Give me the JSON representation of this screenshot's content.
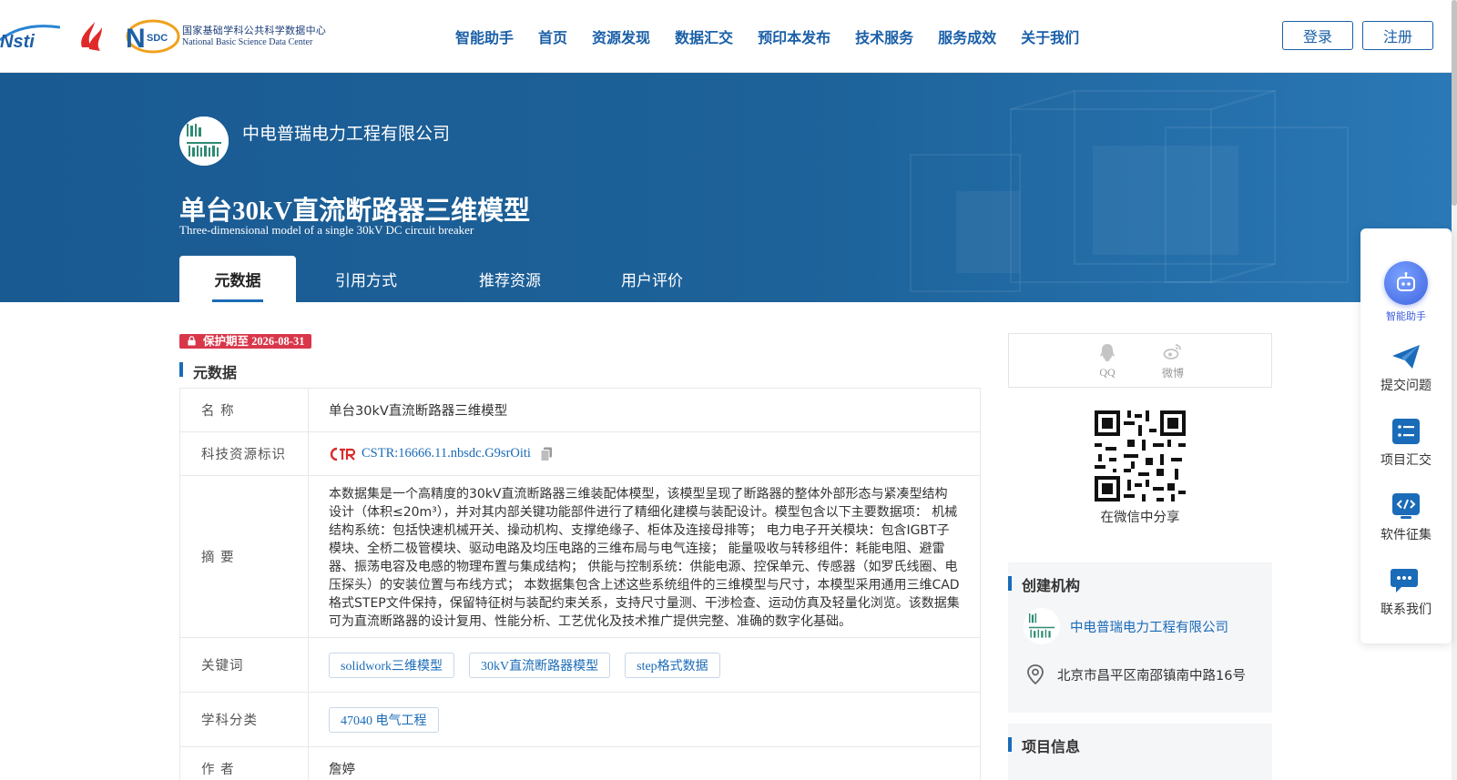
{
  "nav": {
    "logo_cstr_text": "Nsti",
    "nsdc_cn": "国家基础学科公共科学数据中心",
    "nsdc_en": "National Basic Science Data Center",
    "nsdc_mark": "SDC",
    "items": [
      "智能助手",
      "首页",
      "资源发现",
      "数据汇交",
      "预印本发布",
      "技术服务",
      "服务成效",
      "关于我们"
    ],
    "login": "登录",
    "register": "注册"
  },
  "banner": {
    "org_name": "中电普瑞电力工程有限公司",
    "title": "单台30kV直流断路器三维模型",
    "subtitle": "Three-dimensional model of a single 30kV DC circuit breaker",
    "tabs": [
      "元数据",
      "引用方式",
      "推荐资源",
      "用户评价"
    ],
    "active_tab": 0
  },
  "meta": {
    "protect_label": "保护期至 2026-08-31",
    "section_title": "元数据",
    "rows": {
      "name_label": "名 称",
      "name_value": "单台30kV直流断路器三维模型",
      "id_label": "科技资源标识",
      "id_value": "CSTR:16666.11.nbsdc.G9srOiti",
      "abstract_label": "摘 要",
      "abstract_value": "本数据集是一个高精度的30kV直流断路器三维装配体模型，该模型呈现了断路器的整体外部形态与紧凑型结构设计（体积≤20m³），并对其内部关键功能部件进行了精细化建模与装配设计。模型包含以下主要数据项： 机械结构系统：包括快速机械开关、操动机构、支撑绝缘子、柜体及连接母排等； 电力电子开关模块：包含IGBT子模块、全桥二极管模块、驱动电路及均压电路的三维布局与电气连接； 能量吸收与转移组件：耗能电阻、避雷器、振荡电容及电感的物理布置与集成结构； 供能与控制系统：供能电源、控保单元、传感器（如罗氏线圈、电压探头）的安装位置与布线方式； 本数据集包含上述这些系统组件的三维模型与尺寸，本模型采用通用三维CAD格式STEP文件保持，保留特征树与装配约束关系，支持尺寸量测、干涉检查、运动仿真及轻量化浏览。该数据集可为直流断路器的设计复用、性能分析、工艺优化及技术推广提供完整、准确的数字化基础。",
      "keywords_label": "关键词",
      "keywords": [
        "solidwork三维模型",
        "30kV直流断路器模型",
        "step格式数据"
      ],
      "subject_label": "学科分类",
      "subjects": [
        "47040 电气工程"
      ],
      "author_label": "作 者",
      "author_value": "詹婷"
    }
  },
  "sidebar": {
    "share_qq": "QQ",
    "share_weibo": "微博",
    "qr_caption": "在微信中分享",
    "org_heading": "创建机构",
    "org_name": "中电普瑞电力工程有限公司",
    "org_address": "北京市昌平区南邵镇南中路16号",
    "project_heading": "项目信息"
  },
  "side_panel": {
    "items": [
      "智能助手",
      "提交问题",
      "项目汇交",
      "软件征集",
      "联系我们"
    ]
  },
  "colors": {
    "brand_blue": "#1a5fa8",
    "banner_blue": "#1d6299",
    "badge_red": "#d9364a"
  }
}
